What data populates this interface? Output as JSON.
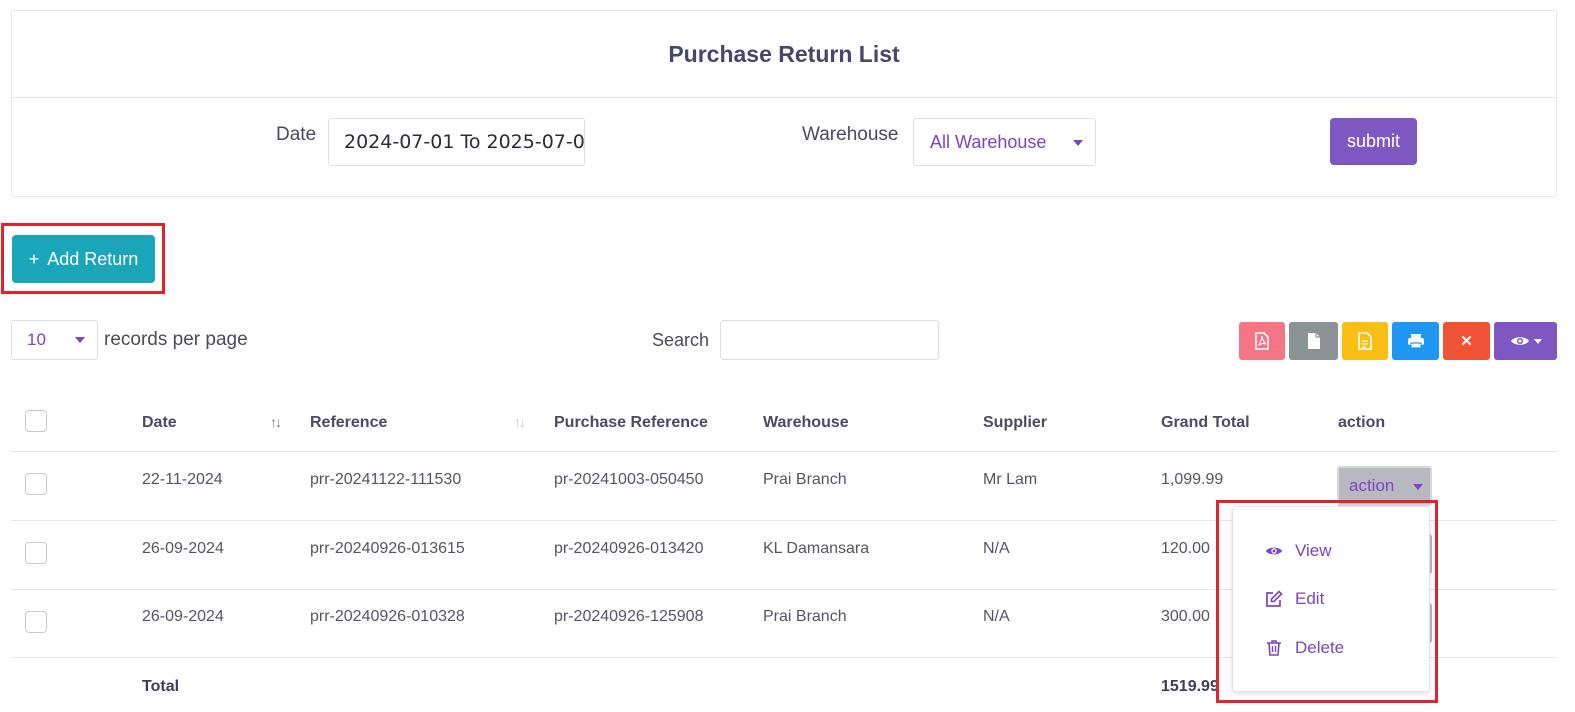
{
  "page": {
    "title": "Purchase Return List"
  },
  "filters": {
    "date_label": "Date",
    "date_value": "2024-07-01 To 2025-07-0",
    "warehouse_label": "Warehouse",
    "warehouse_value": "All Warehouse",
    "submit_label": "submit"
  },
  "add_return_label": "Add Return",
  "add_return_icon": "+",
  "per_page": {
    "value": "10",
    "label": "records per page"
  },
  "search_label": "Search",
  "toolbar": {
    "colors": {
      "pdf": "#f57485",
      "csv": "#8a9296",
      "excel": "#fbbf13",
      "print": "#1e96f3",
      "clear": "#f05236",
      "columns": "#7e57c2"
    },
    "clear_glyph": "✕"
  },
  "table": {
    "headers": [
      "Date",
      "Reference",
      "Purchase Reference",
      "Warehouse",
      "Supplier",
      "Grand Total",
      "action"
    ],
    "rows": [
      {
        "date": "22-11-2024",
        "reference": "prr-20241122-111530",
        "purchase_reference": "pr-20241003-050450",
        "warehouse": "Prai Branch",
        "supplier": "Mr Lam",
        "grand_total": "1,099.99"
      },
      {
        "date": "26-09-2024",
        "reference": "prr-20240926-013615",
        "purchase_reference": "pr-20240926-013420",
        "warehouse": "KL Damansara",
        "supplier": "N/A",
        "grand_total": "120.00"
      },
      {
        "date": "26-09-2024",
        "reference": "prr-20240926-010328",
        "purchase_reference": "pr-20240926-125908",
        "warehouse": "Prai Branch",
        "supplier": "N/A",
        "grand_total": "300.00"
      }
    ],
    "footer": {
      "label": "Total",
      "grand_total": "1519.99"
    },
    "action_label": "action"
  },
  "dropdown": {
    "items": [
      {
        "label": "View",
        "icon": "eye-icon"
      },
      {
        "label": "Edit",
        "icon": "edit-icon"
      },
      {
        "label": "Delete",
        "icon": "trash-icon"
      }
    ]
  }
}
